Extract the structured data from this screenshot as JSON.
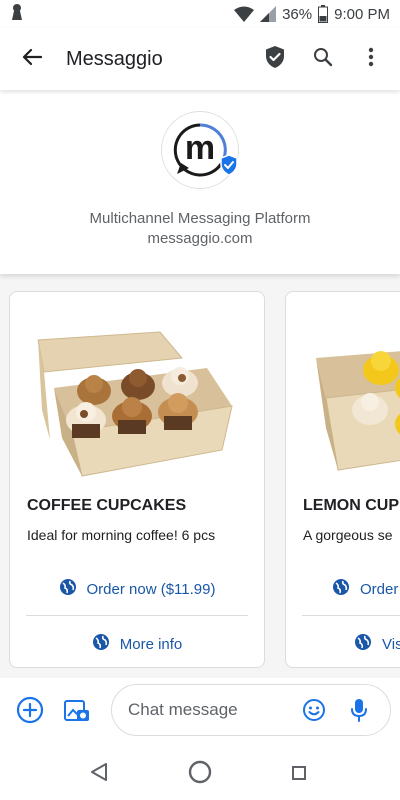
{
  "status_bar": {
    "battery": "36%",
    "time": "9:00 PM",
    "icons": [
      "keyhole-icon",
      "wifi-icon",
      "signal-icon",
      "battery-icon"
    ]
  },
  "app_bar": {
    "title": "Messaggio",
    "icons": [
      "back-arrow-icon",
      "shield-check-icon",
      "search-icon",
      "more-vert-icon"
    ]
  },
  "business": {
    "description": "Multichannel Messaging Platform",
    "url": "messaggio.com",
    "logo_letter": "m"
  },
  "cards": [
    {
      "title": "COFFEE CUPCAKES",
      "description": "Ideal for morning coffee! 6 pcs",
      "actions": [
        {
          "label": "Order now ($11.99)",
          "icon": "globe-icon"
        },
        {
          "label": "More info",
          "icon": "globe-icon"
        }
      ],
      "image": "coffee-cupcakes-box"
    },
    {
      "title": "LEMON CUP",
      "description": "A gorgeous se",
      "actions": [
        {
          "label": "Order",
          "icon": "globe-icon"
        },
        {
          "label": "Vis",
          "icon": "globe-icon"
        }
      ],
      "image": "lemon-cupcakes-box"
    }
  ],
  "compose": {
    "placeholder": "Chat message",
    "icons": [
      "add-circle-icon",
      "gallery-icon",
      "emoji-icon",
      "mic-icon"
    ]
  },
  "nav_bar": {
    "icons": [
      "nav-back-icon",
      "nav-home-icon",
      "nav-recent-icon"
    ]
  },
  "colors": {
    "accent": "#1a57a8",
    "verified": "#1a73e8",
    "background": "#f5f5f5",
    "text": "#202124"
  }
}
